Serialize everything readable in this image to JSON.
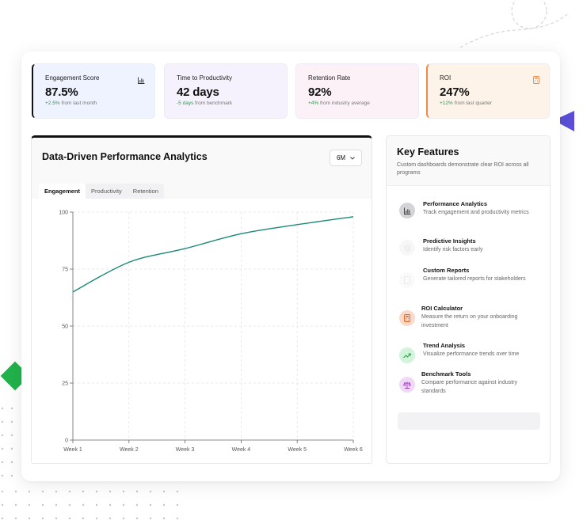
{
  "stats": [
    {
      "title": "Engagement Score",
      "value": "87.5%",
      "delta": "+2.5%",
      "sub": "from last month",
      "icon": "bar-chart-icon"
    },
    {
      "title": "Time to Productivity",
      "value": "42 days",
      "delta": "-5 days",
      "sub": "from benchmark",
      "icon": ""
    },
    {
      "title": "Retention Rate",
      "value": "92%",
      "delta": "+4%",
      "sub": "from industry average",
      "icon": ""
    },
    {
      "title": "ROI",
      "value": "247%",
      "delta": "+12%",
      "sub": "from last quarter",
      "icon": "calculator-icon"
    }
  ],
  "analytics": {
    "title": "Data-Driven Performance Analytics",
    "range": "6M",
    "tabs": [
      "Engagement",
      "Productivity",
      "Retention"
    ],
    "active_tab": "Engagement"
  },
  "chart_data": {
    "type": "line",
    "categories": [
      "Week 1",
      "Week 2",
      "Week 3",
      "Week 4",
      "Week 5",
      "Week 6"
    ],
    "series": [
      {
        "values": [
          65,
          78,
          84,
          90.5,
          94.5,
          98
        ]
      }
    ],
    "yticks": [
      0,
      25,
      50,
      75,
      100
    ],
    "ylim": [
      0,
      100
    ],
    "grid": true,
    "colors": {
      "line": "#1a8a78"
    }
  },
  "features": {
    "title": "Key Features",
    "description": "Custom dashboards demonstrate clear ROI across all programs",
    "items": [
      {
        "name": "Performance Analytics",
        "text": "Track engagement and productivity metrics",
        "icon": "bar-chart-icon"
      },
      {
        "name": "Predictive Insights",
        "text": "Identify risk factors early",
        "icon": "target-icon"
      },
      {
        "name": "Custom Reports",
        "text": "Generate tailored reports for stakeholders",
        "icon": "document-icon"
      },
      {
        "name": "ROI Calculator",
        "text": "Measure the return on your onboarding investment",
        "icon": "calculator-icon"
      },
      {
        "name": "Trend Analysis",
        "text": "Visualize performance trends over time",
        "icon": "trending-up-icon"
      },
      {
        "name": "Benchmark Tools",
        "text": "Compare performance against industry standards",
        "icon": "scale-icon"
      }
    ]
  },
  "colors": {
    "accent_green": "#22a24a",
    "diamond": "#22b24c",
    "triangle": "#5b4fd8",
    "roi_border": "#f08a48"
  }
}
